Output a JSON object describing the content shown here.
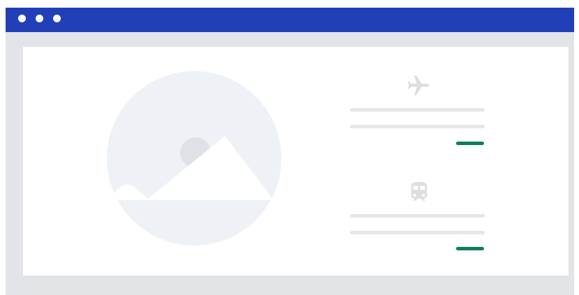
{
  "window": {
    "titlebar_color": "#2140b8",
    "controls": [
      "window-dot",
      "window-dot",
      "window-dot"
    ]
  },
  "content": {
    "hero": {
      "icon": "image-placeholder-icon"
    },
    "cards": [
      {
        "icon": "airplane-icon",
        "accent_color": "#0f7d5c"
      },
      {
        "icon": "train-icon",
        "accent_color": "#0f7d5c"
      }
    ]
  }
}
